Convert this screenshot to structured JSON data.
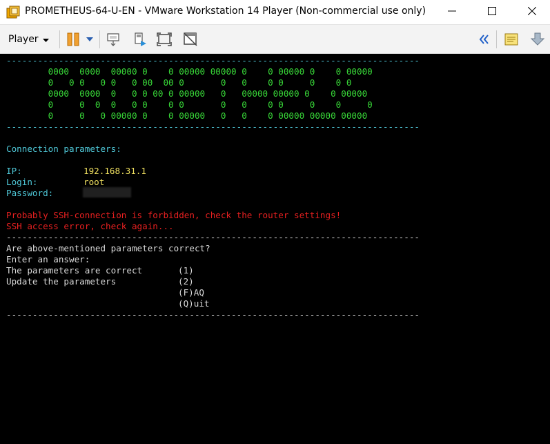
{
  "window": {
    "title": "PROMETHEUS-64-U-EN - VMware Workstation 14 Player (Non-commercial use only)"
  },
  "toolbar": {
    "player_label": "Player"
  },
  "console": {
    "separator": "-------------------------------------------------------------------------------",
    "banner": [
      "        0000  0000  00000 0    0 00000 00000 0    0 00000 0    0 00000",
      "        0   0 0   0 0   0 00  00 0       0   0    0 0     0    0 0",
      "        0000  0000  0   0 0 00 0 00000   0   00000 00000 0    0 00000",
      "        0     0  0  0   0 0    0 0       0   0    0 0     0    0     0",
      "        0     0   0 00000 0    0 00000   0   0    0 00000 00000 00000"
    ],
    "params_heading": "Connection parameters:",
    "ip_label": "IP:",
    "ip_value": "192.168.31.1",
    "login_label": "Login:",
    "login_value": "root",
    "password_label": "Password:",
    "error_ssh_forbidden": "Probably SSH-connection is forbidden, check the router settings!",
    "error_access": "SSH access error, check again...",
    "question": "Are above-mentioned parameters correct?",
    "prompt": "Enter an answer:",
    "options": [
      {
        "label": "The parameters are correct",
        "key": "(1)"
      },
      {
        "label": "Update the parameters",
        "key": "(2)"
      },
      {
        "label": "",
        "key": "(F)AQ"
      },
      {
        "label": "",
        "key": "(Q)uit"
      }
    ]
  }
}
